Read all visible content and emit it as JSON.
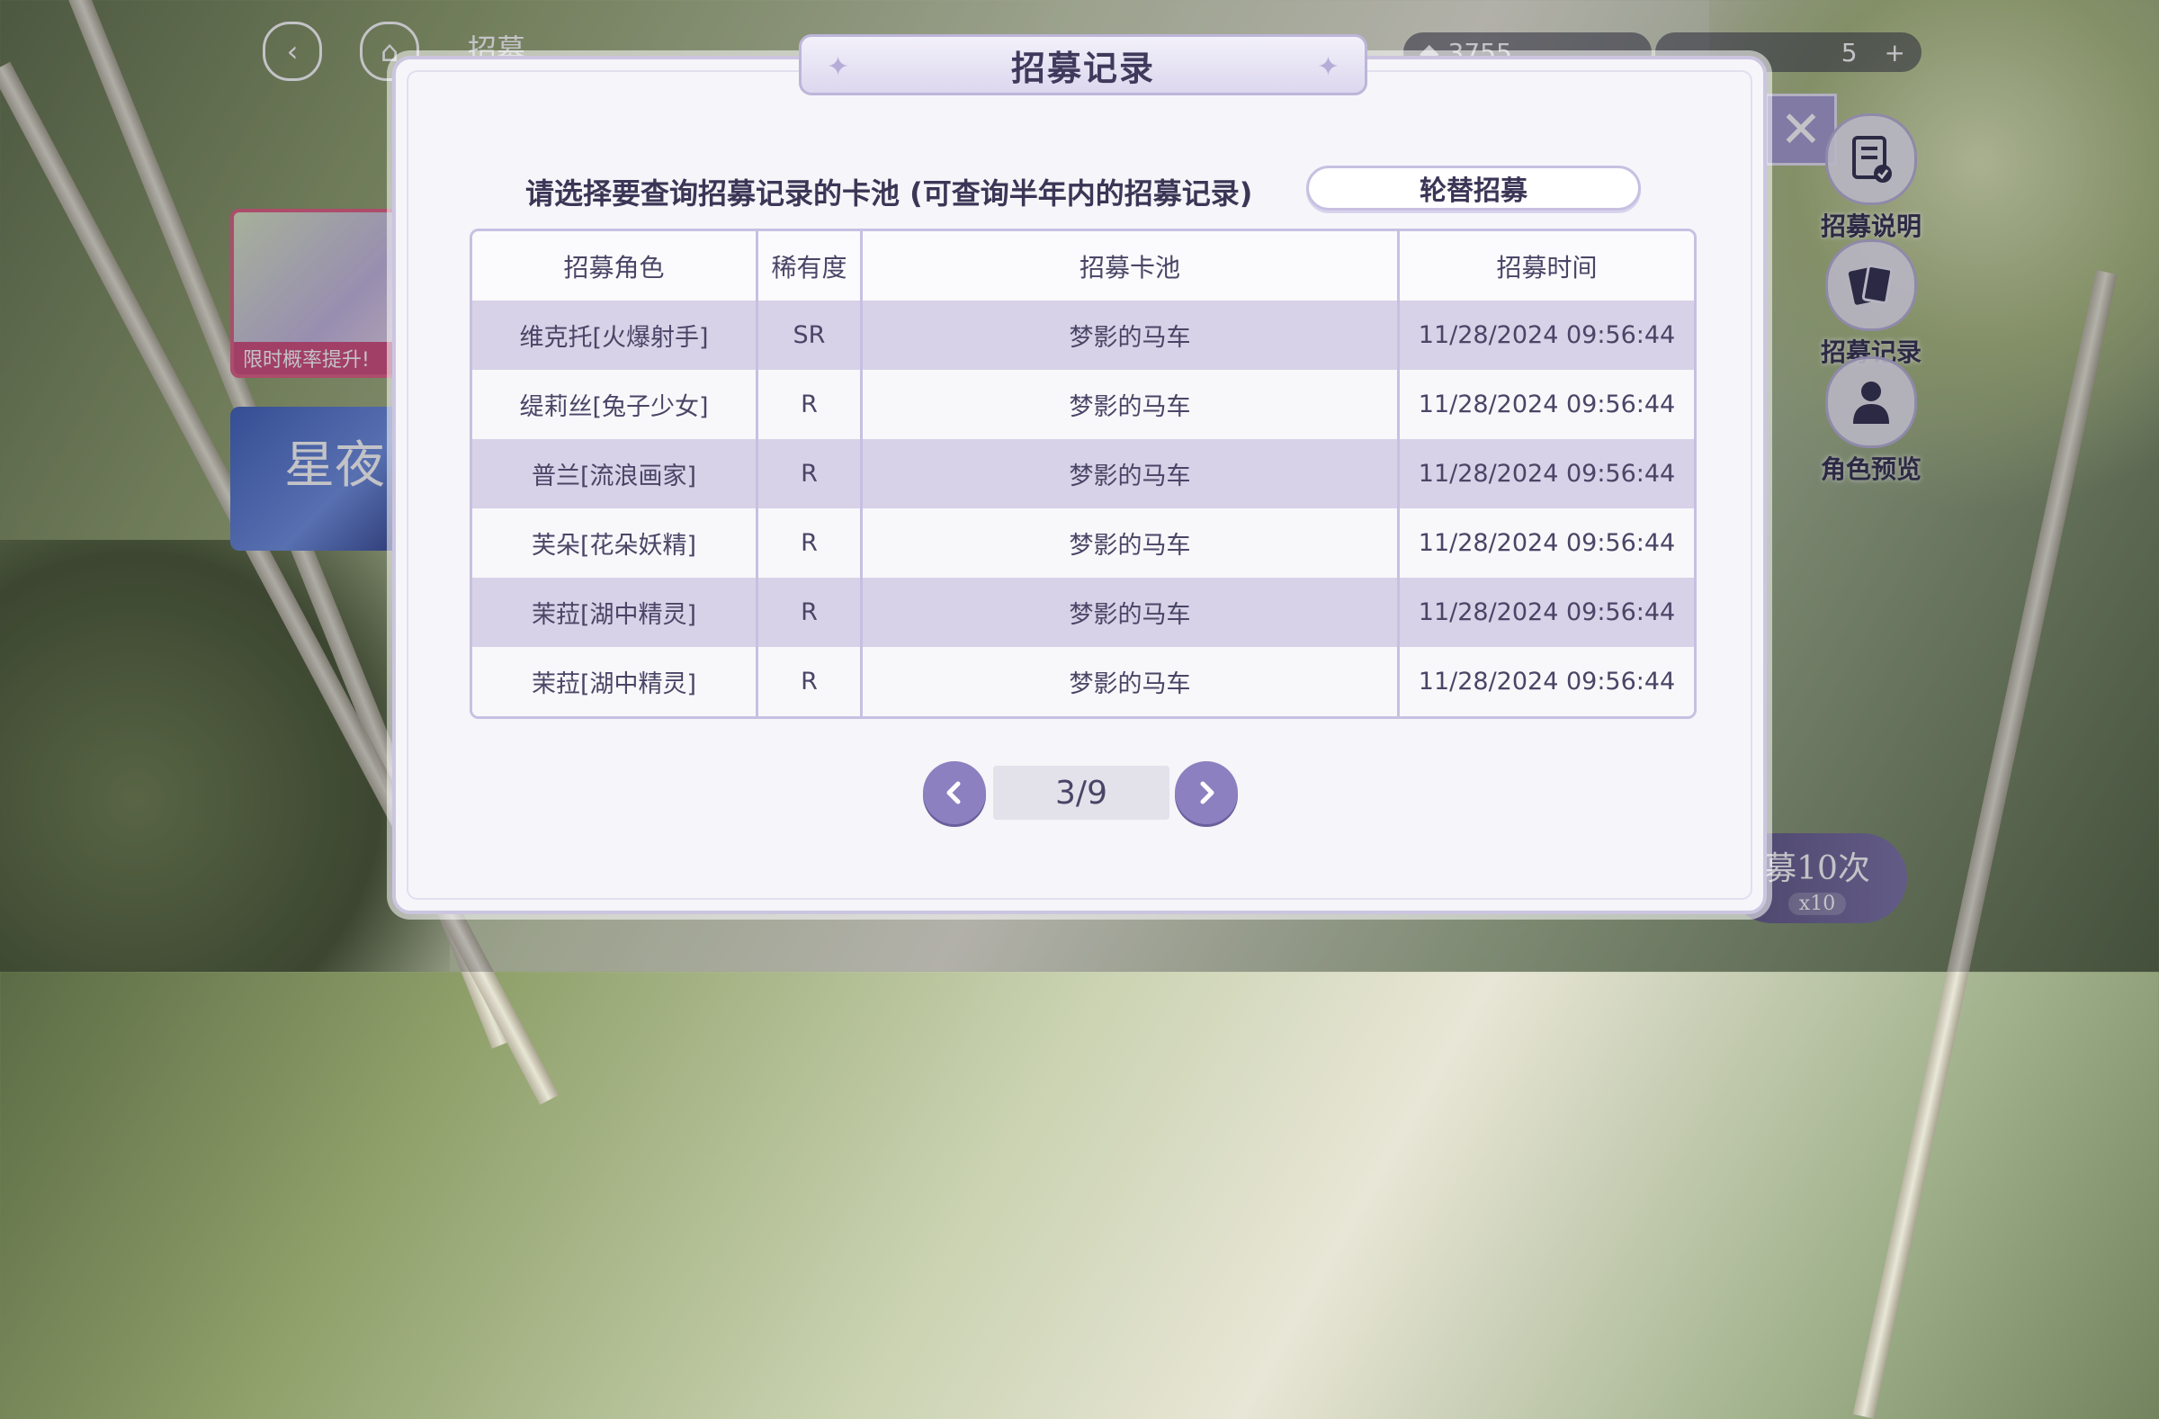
{
  "background": {
    "top_nav_title": "招募",
    "resource_amount": "3755",
    "ticket_count": "5",
    "banner_limited_tag": "限时概率提升!",
    "banner_second_title": "星夜",
    "draw_ten_label": "募10次",
    "draw_ten_cost": "x10"
  },
  "side_menu": {
    "items": [
      {
        "label": "招募说明",
        "icon": "document-check-icon"
      },
      {
        "label": "招募记录",
        "icon": "cards-icon"
      },
      {
        "label": "角色预览",
        "icon": "person-icon"
      }
    ]
  },
  "modal": {
    "title": "招募记录",
    "prompt": "请选择要查询招募记录的卡池 (可查询半年内的招募记录)",
    "pool_select": "轮替招募",
    "table": {
      "headers": [
        "招募角色",
        "稀有度",
        "招募卡池",
        "招募时间"
      ],
      "rows": [
        [
          "维克托[火爆射手]",
          "SR",
          "梦影的马车",
          "11/28/2024 09:56:44"
        ],
        [
          "缇莉丝[兔子少女]",
          "R",
          "梦影的马车",
          "11/28/2024 09:56:44"
        ],
        [
          "普兰[流浪画家]",
          "R",
          "梦影的马车",
          "11/28/2024 09:56:44"
        ],
        [
          "芙朵[花朵妖精]",
          "R",
          "梦影的马车",
          "11/28/2024 09:56:44"
        ],
        [
          "茉菈[湖中精灵]",
          "R",
          "梦影的马车",
          "11/28/2024 09:56:44"
        ],
        [
          "茉菈[湖中精灵]",
          "R",
          "梦影的马车",
          "11/28/2024 09:56:44"
        ]
      ]
    },
    "pagination": {
      "page": "3/9"
    }
  },
  "colors": {
    "accent": "#8c80c0",
    "row_shade": "#d7d2e7",
    "border": "#c7c0e2",
    "text": "#4a4566"
  }
}
